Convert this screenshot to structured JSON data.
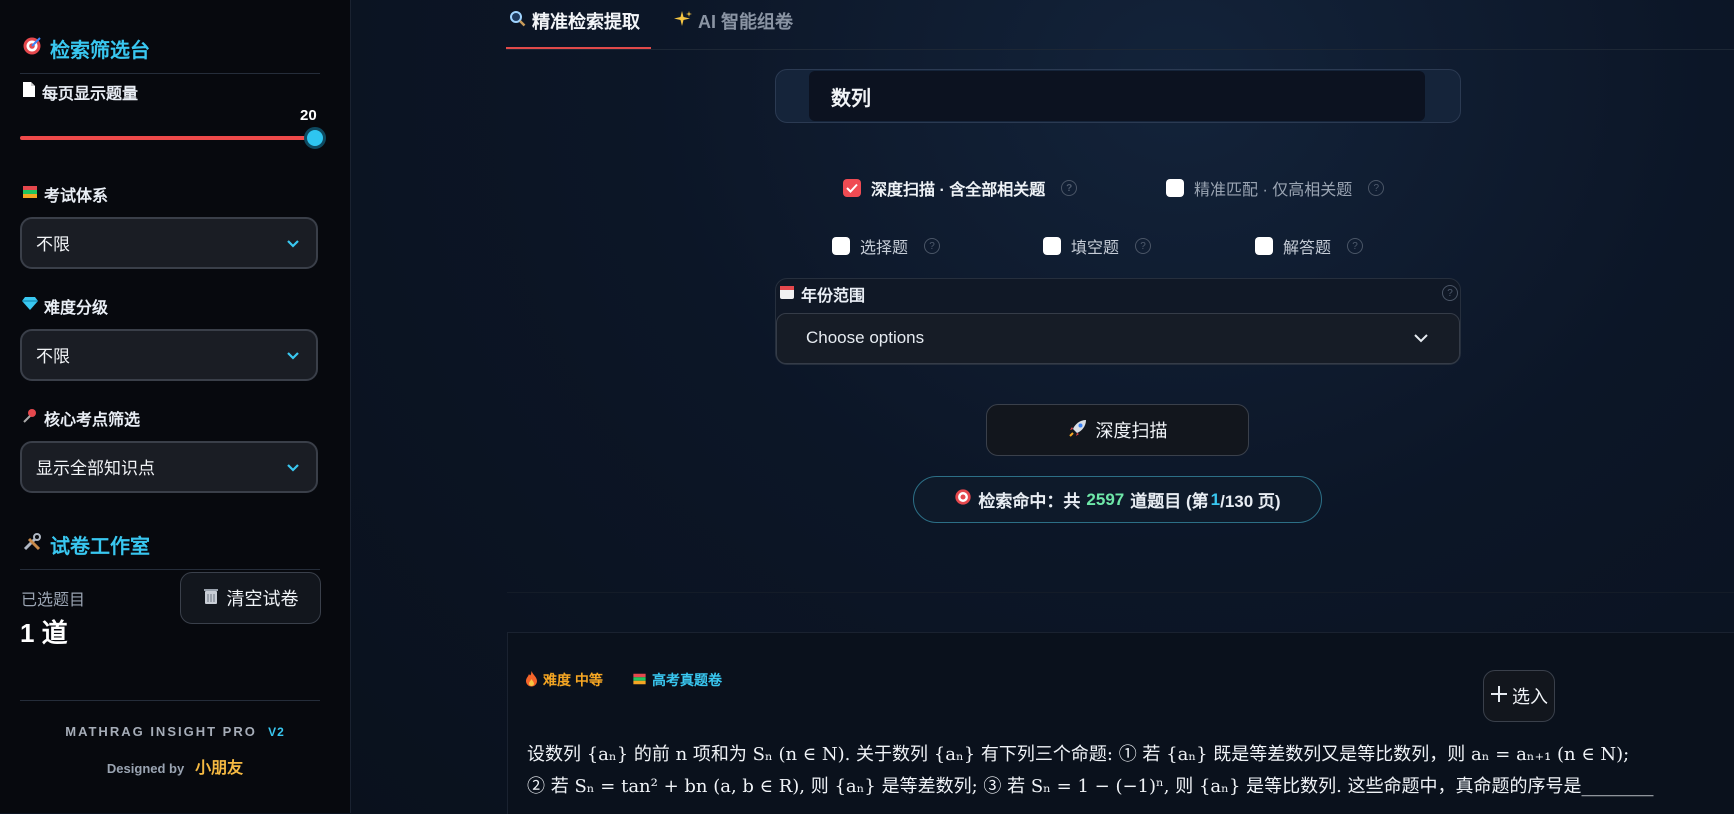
{
  "sidebar": {
    "filter_title": "检索筛选台",
    "per_page_label": "每页显示题量",
    "per_page_value": "20",
    "exam_system_label": "考试体系",
    "exam_system_value": "不限",
    "difficulty_label": "难度分级",
    "difficulty_value": "不限",
    "core_points_label": "核心考点筛选",
    "core_points_value": "显示全部知识点",
    "workshop_title": "试卷工作室",
    "selected_label": "已选题目",
    "selected_count": "1 道",
    "clear_button": "清空试卷",
    "brand": "MATHRAG INSIGHT PRO",
    "version": "V2",
    "designed_by": "Designed by",
    "author": "小朋友"
  },
  "tabs": [
    {
      "label": "精准检索提取"
    },
    {
      "label": "AI 智能组卷"
    }
  ],
  "search": {
    "value": "数列"
  },
  "options": {
    "deep_scan_label": "深度扫描 · 含全部相关题",
    "precise_match_label": "精准匹配 · 仅高相关题",
    "choice_label": "选择题",
    "fill_label": "填空题",
    "answer_label": "解答题"
  },
  "year": {
    "label": "年份范围",
    "placeholder": "Choose options"
  },
  "scan_button": "深度扫描",
  "result": {
    "prefix": "检索命中：共",
    "total": "2597",
    "middle": "道题目 (第",
    "page": "1",
    "suffix": "/130 页)"
  },
  "card": {
    "difficulty_tag": "难度 中等",
    "source_tag": "高考真题卷",
    "select_button": "选入",
    "question_line1": "设数列 {aₙ} 的前 n 项和为 Sₙ (n ∈ N). 关于数列 {aₙ} 有下列三个命题: ① 若 {aₙ} 既是等差数列又是等比数列，则 aₙ = aₙ₊₁ (n ∈ N);",
    "question_line2": "② 若 Sₙ = tan² + bn (a, b ∈ R), 则 {aₙ} 是等差数列; ③ 若 Sₙ = 1 − (−1)ⁿ, 则 {aₙ} 是等比数列. 这些命题中，真命题的序号是________"
  },
  "colors": {
    "accent_cyan": "#39c7f0",
    "accent_red": "#ef4a4a",
    "highlight_green": "#6ee7a8",
    "tag_orange": "#f5a623"
  }
}
